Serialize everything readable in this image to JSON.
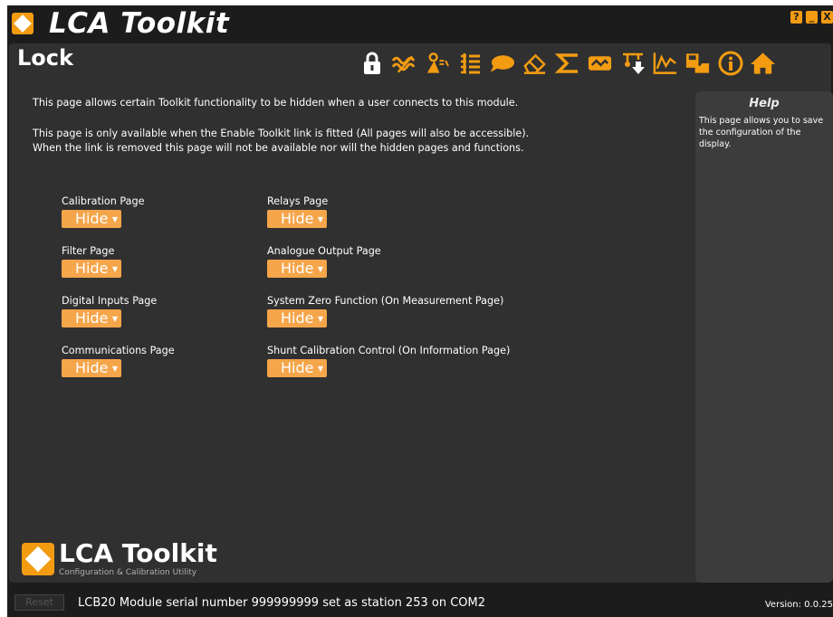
{
  "app": {
    "title": "LCA Toolkit",
    "accent_color": "#f39c12",
    "window_buttons": [
      "?",
      "_",
      "X"
    ]
  },
  "page": {
    "title": "Lock",
    "description": [
      "This page allows certain Toolkit functionality to be hidden when a user connects to this module.",
      "This page is only available when the Enable Toolkit link is fitted (All pages will also be accessible).",
      "When the link is removed this page will not be available nor will the hidden pages and functions."
    ]
  },
  "toolbar": {
    "icons": [
      "lock-icon",
      "filter-icon",
      "zero-icon",
      "list-icon",
      "speech-icon",
      "eraser-icon",
      "sigma-icon",
      "signal-icon",
      "download-icon",
      "chart-icon",
      "save-icon",
      "info-icon",
      "home-icon"
    ]
  },
  "settings": {
    "left": [
      {
        "label": "Calibration Page",
        "value": "Hide"
      },
      {
        "label": "Filter Page",
        "value": "Hide"
      },
      {
        "label": "Digital Inputs Page",
        "value": "Hide"
      },
      {
        "label": "Communications Page",
        "value": "Hide"
      }
    ],
    "right": [
      {
        "label": "Relays Page",
        "value": "Hide"
      },
      {
        "label": "Analogue Output Page",
        "value": "Hide"
      },
      {
        "label": "System Zero Function (On Measurement Page)",
        "value": "Hide"
      },
      {
        "label": "Shunt Calibration Control (On Information Page)",
        "value": "Hide"
      }
    ]
  },
  "help": {
    "title": "Help",
    "text": "This page allows you to save the configuration of the display."
  },
  "logo": {
    "title": "LCA Toolkit",
    "subtitle": "Configuration & Calibration Utility"
  },
  "status": {
    "reset_label": "Reset",
    "message": "LCB20 Module serial number 999999999 set as station 253 on COM2",
    "version": "Version: 0.0.25"
  }
}
